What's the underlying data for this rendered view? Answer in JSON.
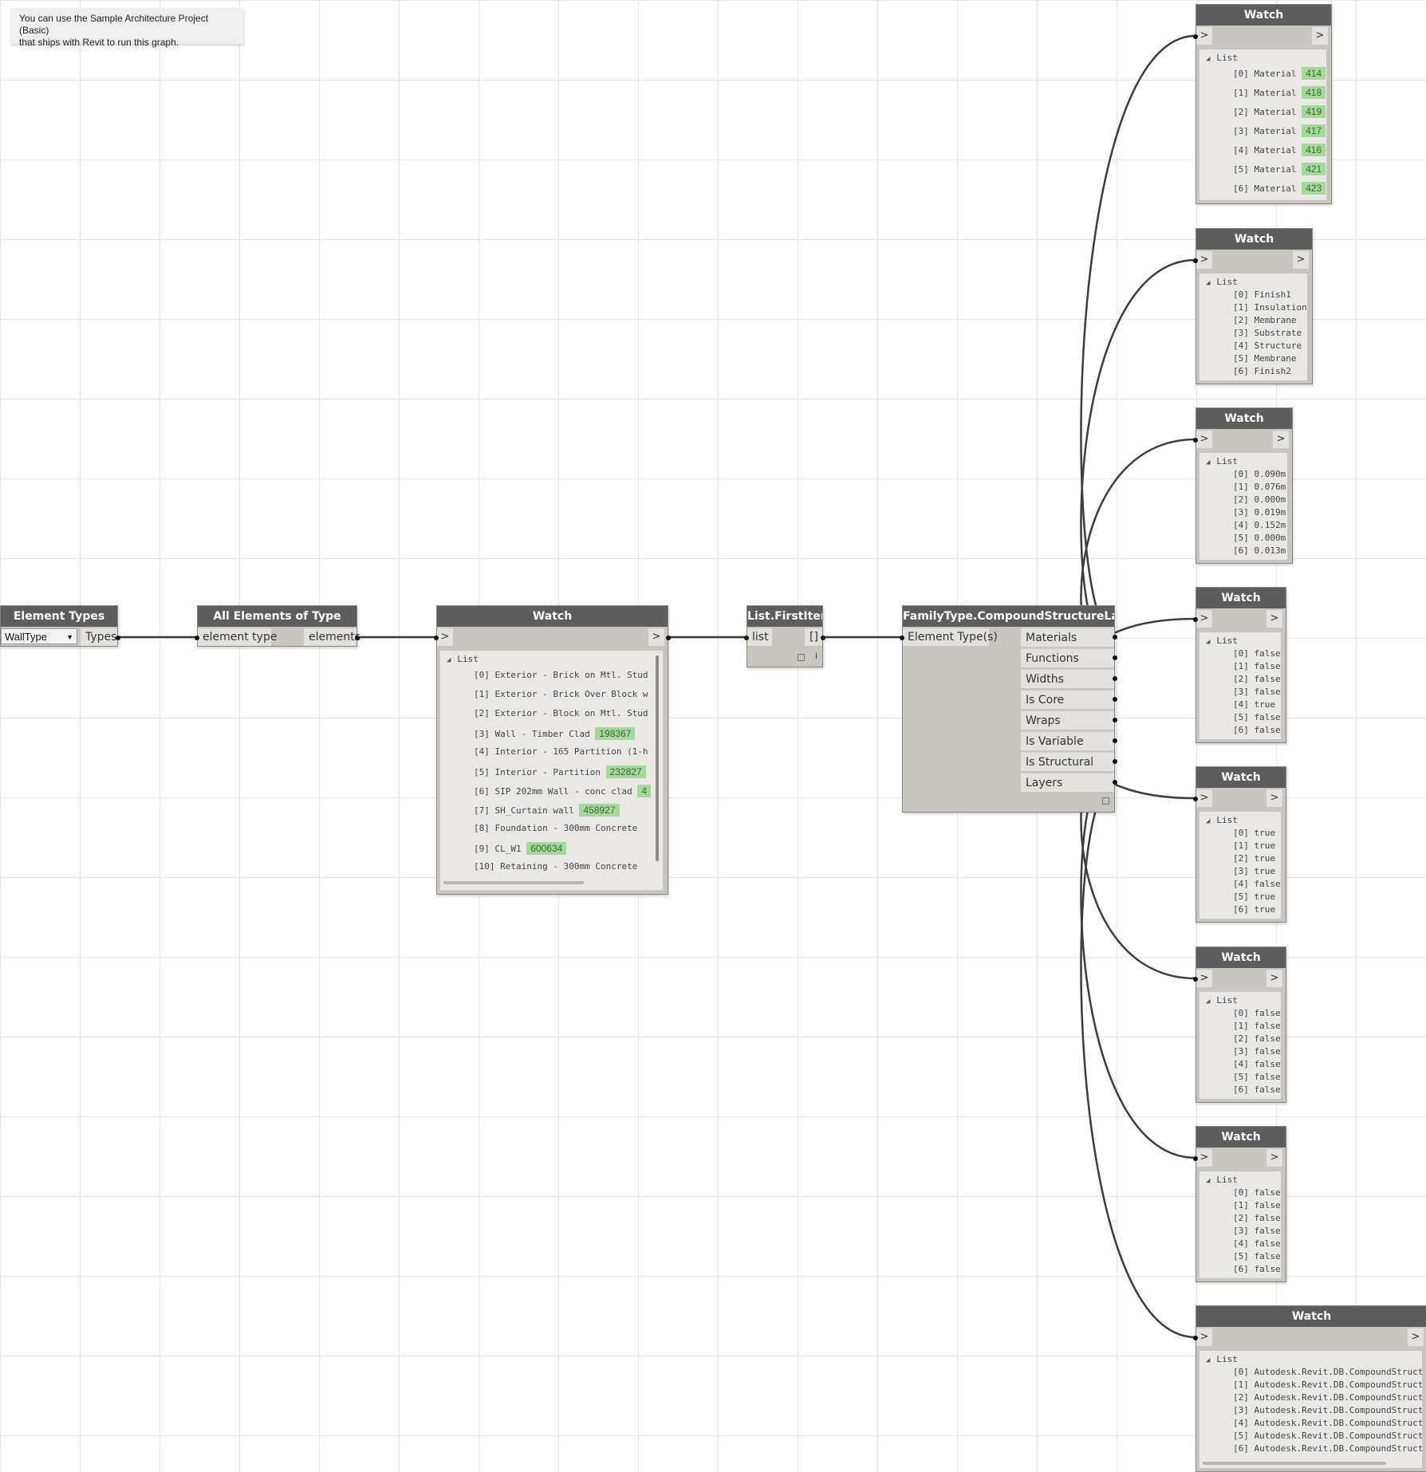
{
  "note": {
    "line1": "You can use the Sample Architecture Project (Basic)",
    "line2": "that ships with Revit to run this graph."
  },
  "element_types": {
    "title": "Element Types",
    "dropdown_value": "WallType",
    "output": "Types"
  },
  "all_elements": {
    "title": "All Elements of Type",
    "input": "element type",
    "output": "elements"
  },
  "watch_main": {
    "title": "Watch",
    "in": ">",
    "out": ">",
    "list_label": "List",
    "items": [
      {
        "idx": "[0]",
        "text": "Exterior - Brick on Mtl. Stud",
        "id": ""
      },
      {
        "idx": "[1]",
        "text": "Exterior - Brick Over Block w",
        "id": ""
      },
      {
        "idx": "[2]",
        "text": "Exterior - Block on Mtl. Stud",
        "id": ""
      },
      {
        "idx": "[3]",
        "text": "Wall - Timber Clad",
        "id": "198367"
      },
      {
        "idx": "[4]",
        "text": "Interior - 165 Partition (1-h",
        "id": ""
      },
      {
        "idx": "[5]",
        "text": "Interior - Partition",
        "id": "232827"
      },
      {
        "idx": "[6]",
        "text": "SIP 202mm Wall - conc clad",
        "id": "4"
      },
      {
        "idx": "[7]",
        "text": "SH_Curtain wall",
        "id": "458927"
      },
      {
        "idx": "[8]",
        "text": "Foundation - 300mm Concrete",
        "id": ""
      },
      {
        "idx": "[9]",
        "text": "CL_W1",
        "id": "600634"
      },
      {
        "idx": "[10]",
        "text": "Retaining - 300mm Concrete",
        "id": ""
      }
    ]
  },
  "first_item": {
    "title": "List.FirstItem",
    "input": "list",
    "output": "[]",
    "lacing": "l"
  },
  "compound": {
    "title": "FamilyType.CompoundStructureLayers",
    "input": "Element Type(s)",
    "outputs": [
      "Materials",
      "Functions",
      "Widths",
      "Is Core",
      "Wraps",
      "Is Variable",
      "Is Structural Deck",
      "Layers"
    ]
  },
  "watches": [
    {
      "title": "Watch",
      "in": ">",
      "out": ">",
      "list_label": "List",
      "items": [
        {
          "idx": "[0]",
          "text": "Material",
          "id": "414"
        },
        {
          "idx": "[1]",
          "text": "Material",
          "id": "418"
        },
        {
          "idx": "[2]",
          "text": "Material",
          "id": "419"
        },
        {
          "idx": "[3]",
          "text": "Material",
          "id": "417"
        },
        {
          "idx": "[4]",
          "text": "Material",
          "id": "416"
        },
        {
          "idx": "[5]",
          "text": "Material",
          "id": "421"
        },
        {
          "idx": "[6]",
          "text": "Material",
          "id": "423"
        }
      ]
    },
    {
      "title": "Watch",
      "in": ">",
      "out": ">",
      "list_label": "List",
      "items": [
        {
          "idx": "[0]",
          "text": "Finish1"
        },
        {
          "idx": "[1]",
          "text": "Insulation"
        },
        {
          "idx": "[2]",
          "text": "Membrane"
        },
        {
          "idx": "[3]",
          "text": "Substrate"
        },
        {
          "idx": "[4]",
          "text": "Structure"
        },
        {
          "idx": "[5]",
          "text": "Membrane"
        },
        {
          "idx": "[6]",
          "text": "Finish2"
        }
      ]
    },
    {
      "title": "Watch",
      "in": ">",
      "out": ">",
      "list_label": "List",
      "items": [
        {
          "idx": "[0]",
          "text": "0.090m"
        },
        {
          "idx": "[1]",
          "text": "0.076m"
        },
        {
          "idx": "[2]",
          "text": "0.000m"
        },
        {
          "idx": "[3]",
          "text": "0.019m"
        },
        {
          "idx": "[4]",
          "text": "0.152m"
        },
        {
          "idx": "[5]",
          "text": "0.000m"
        },
        {
          "idx": "[6]",
          "text": "0.013m"
        }
      ]
    },
    {
      "title": "Watch",
      "in": ">",
      "out": ">",
      "list_label": "List",
      "items": [
        {
          "idx": "[0]",
          "text": "false"
        },
        {
          "idx": "[1]",
          "text": "false"
        },
        {
          "idx": "[2]",
          "text": "false"
        },
        {
          "idx": "[3]",
          "text": "false"
        },
        {
          "idx": "[4]",
          "text": "true"
        },
        {
          "idx": "[5]",
          "text": "false"
        },
        {
          "idx": "[6]",
          "text": "false"
        }
      ]
    },
    {
      "title": "Watch",
      "in": ">",
      "out": ">",
      "list_label": "List",
      "items": [
        {
          "idx": "[0]",
          "text": "true"
        },
        {
          "idx": "[1]",
          "text": "true"
        },
        {
          "idx": "[2]",
          "text": "true"
        },
        {
          "idx": "[3]",
          "text": "true"
        },
        {
          "idx": "[4]",
          "text": "false"
        },
        {
          "idx": "[5]",
          "text": "true"
        },
        {
          "idx": "[6]",
          "text": "true"
        }
      ]
    },
    {
      "title": "Watch",
      "in": ">",
      "out": ">",
      "list_label": "List",
      "items": [
        {
          "idx": "[0]",
          "text": "false"
        },
        {
          "idx": "[1]",
          "text": "false"
        },
        {
          "idx": "[2]",
          "text": "false"
        },
        {
          "idx": "[3]",
          "text": "false"
        },
        {
          "idx": "[4]",
          "text": "false"
        },
        {
          "idx": "[5]",
          "text": "false"
        },
        {
          "idx": "[6]",
          "text": "false"
        }
      ]
    },
    {
      "title": "Watch",
      "in": ">",
      "out": ">",
      "list_label": "List",
      "items": [
        {
          "idx": "[0]",
          "text": "false"
        },
        {
          "idx": "[1]",
          "text": "false"
        },
        {
          "idx": "[2]",
          "text": "false"
        },
        {
          "idx": "[3]",
          "text": "false"
        },
        {
          "idx": "[4]",
          "text": "false"
        },
        {
          "idx": "[5]",
          "text": "false"
        },
        {
          "idx": "[6]",
          "text": "false"
        }
      ]
    },
    {
      "title": "Watch",
      "in": ">",
      "out": ">",
      "list_label": "List",
      "items": [
        {
          "idx": "[0]",
          "text": "Autodesk.Revit.DB.CompoundStruct"
        },
        {
          "idx": "[1]",
          "text": "Autodesk.Revit.DB.CompoundStruct"
        },
        {
          "idx": "[2]",
          "text": "Autodesk.Revit.DB.CompoundStruct"
        },
        {
          "idx": "[3]",
          "text": "Autodesk.Revit.DB.CompoundStruct"
        },
        {
          "idx": "[4]",
          "text": "Autodesk.Revit.DB.CompoundStruct"
        },
        {
          "idx": "[5]",
          "text": "Autodesk.Revit.DB.CompoundStruct"
        },
        {
          "idx": "[6]",
          "text": "Autodesk.Revit.DB.CompoundStruct"
        }
      ]
    }
  ]
}
